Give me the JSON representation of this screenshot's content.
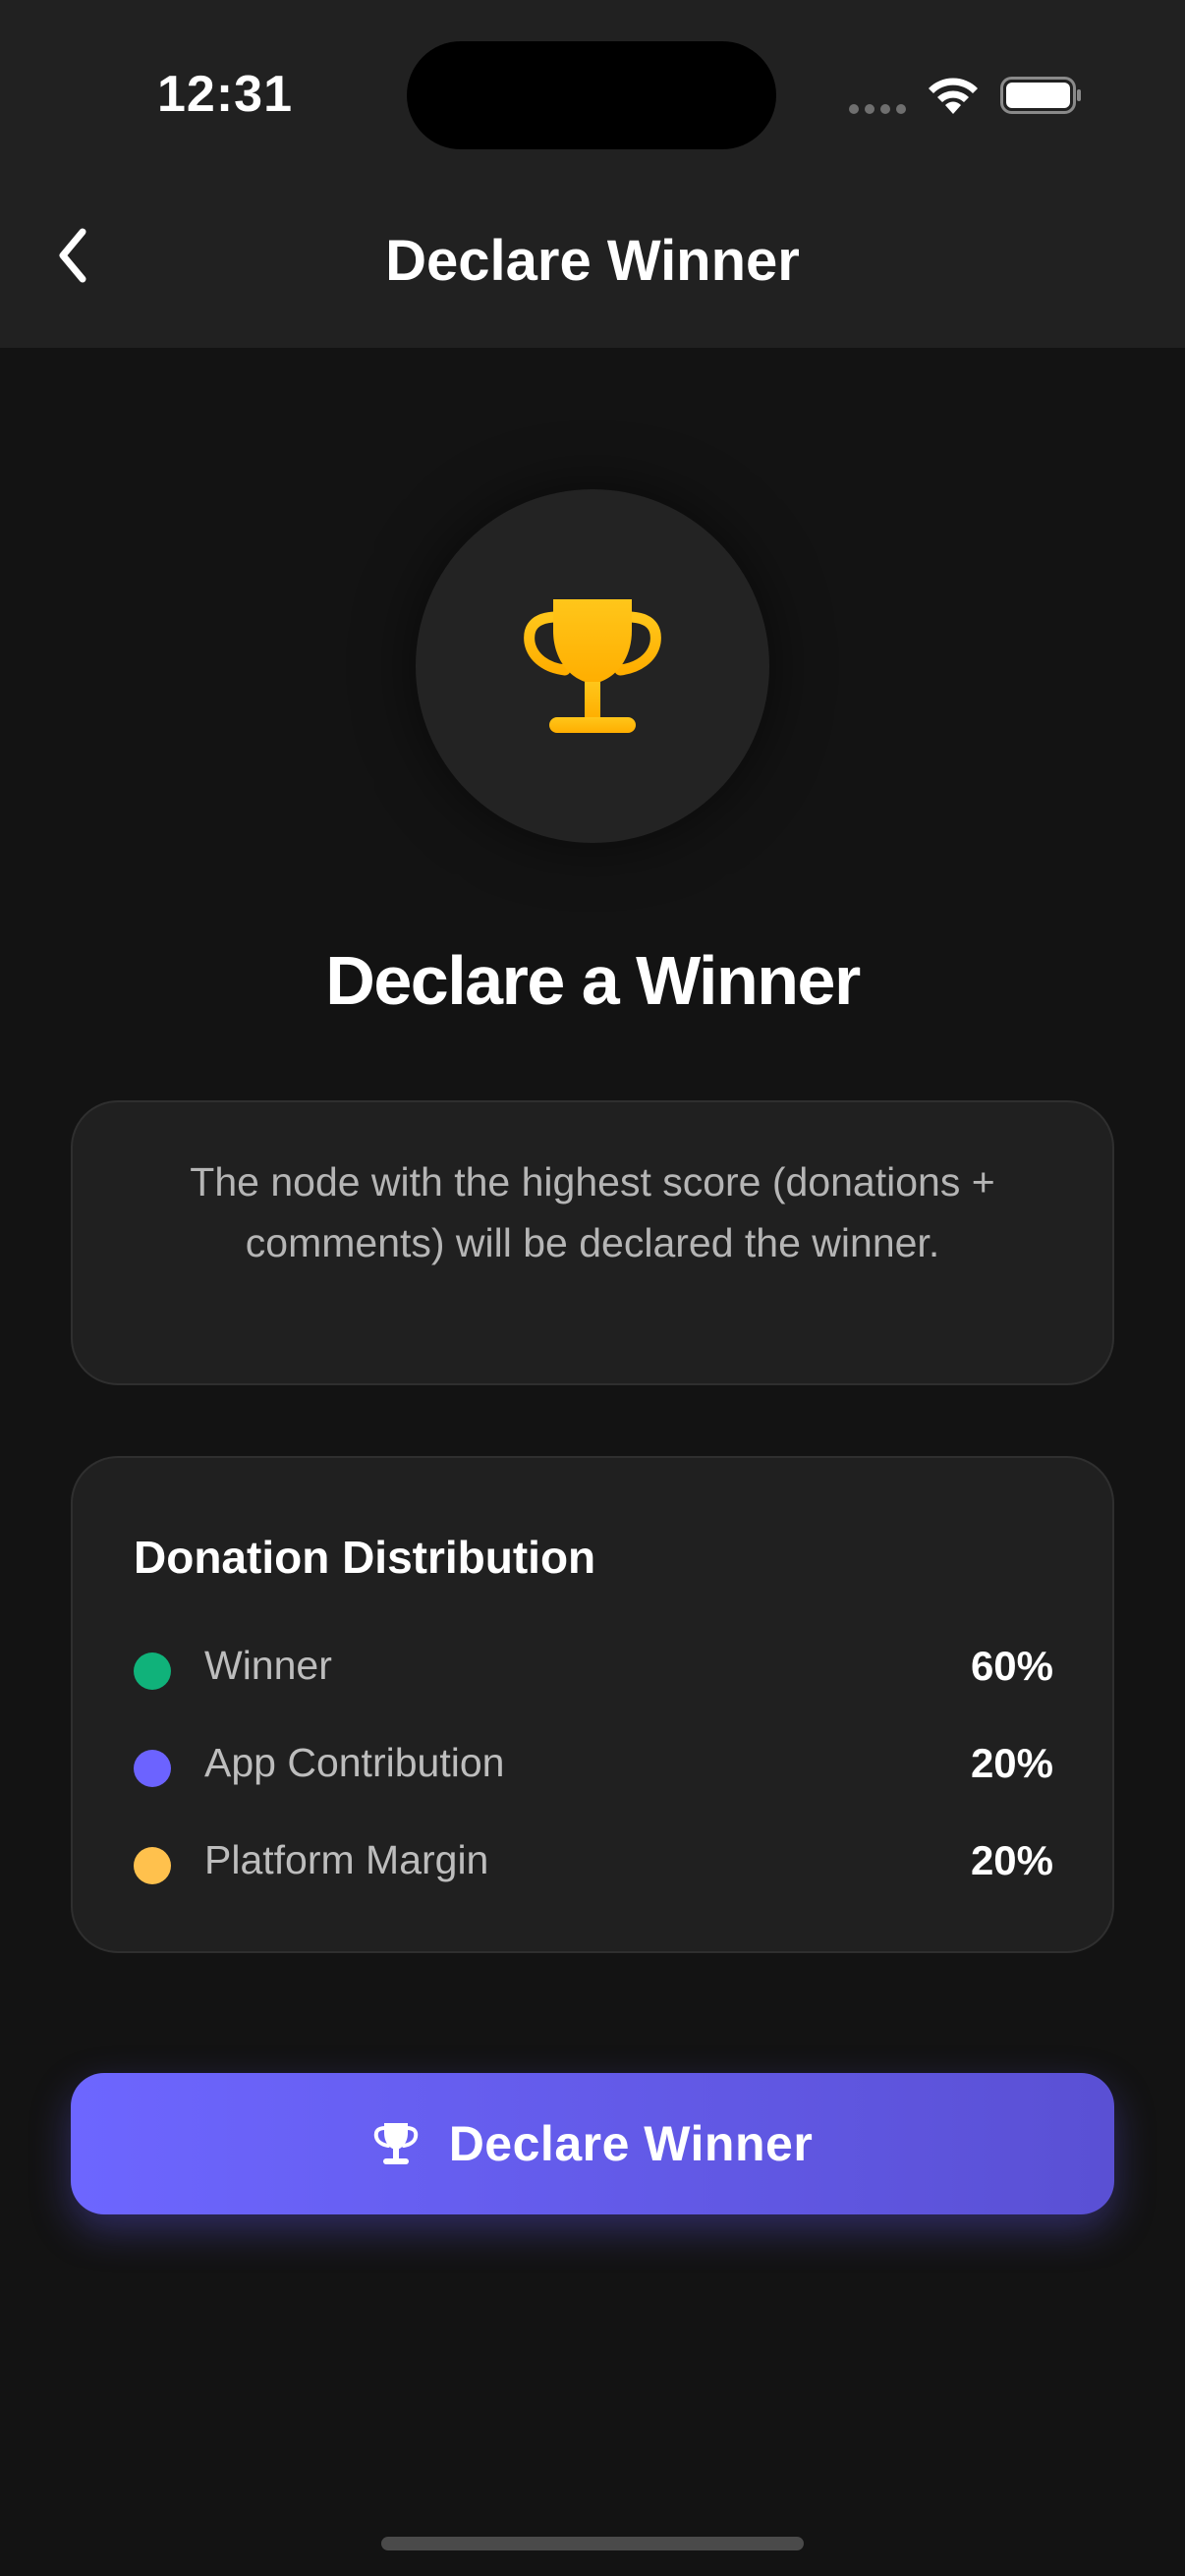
{
  "status_bar": {
    "time": "12:31"
  },
  "nav": {
    "title": "Declare Winner",
    "back_icon": "chevron-left-icon"
  },
  "hero": {
    "icon": "trophy-icon",
    "icon_color": "#FFC107",
    "heading": "Declare a Winner"
  },
  "info": {
    "text": "The node with the highest score (donations + comments) will be declared the winner."
  },
  "distribution": {
    "title": "Donation Distribution",
    "items": [
      {
        "label": "Winner",
        "value": "60%",
        "color": "#10B27A"
      },
      {
        "label": "App Contribution",
        "value": "20%",
        "color": "#6C63FF"
      },
      {
        "label": "Platform Margin",
        "value": "20%",
        "color": "#FFC14D"
      }
    ]
  },
  "action": {
    "label": "Declare Winner",
    "icon": "trophy-icon",
    "gradient": [
      "#6D66FF",
      "#5A50D4"
    ]
  }
}
